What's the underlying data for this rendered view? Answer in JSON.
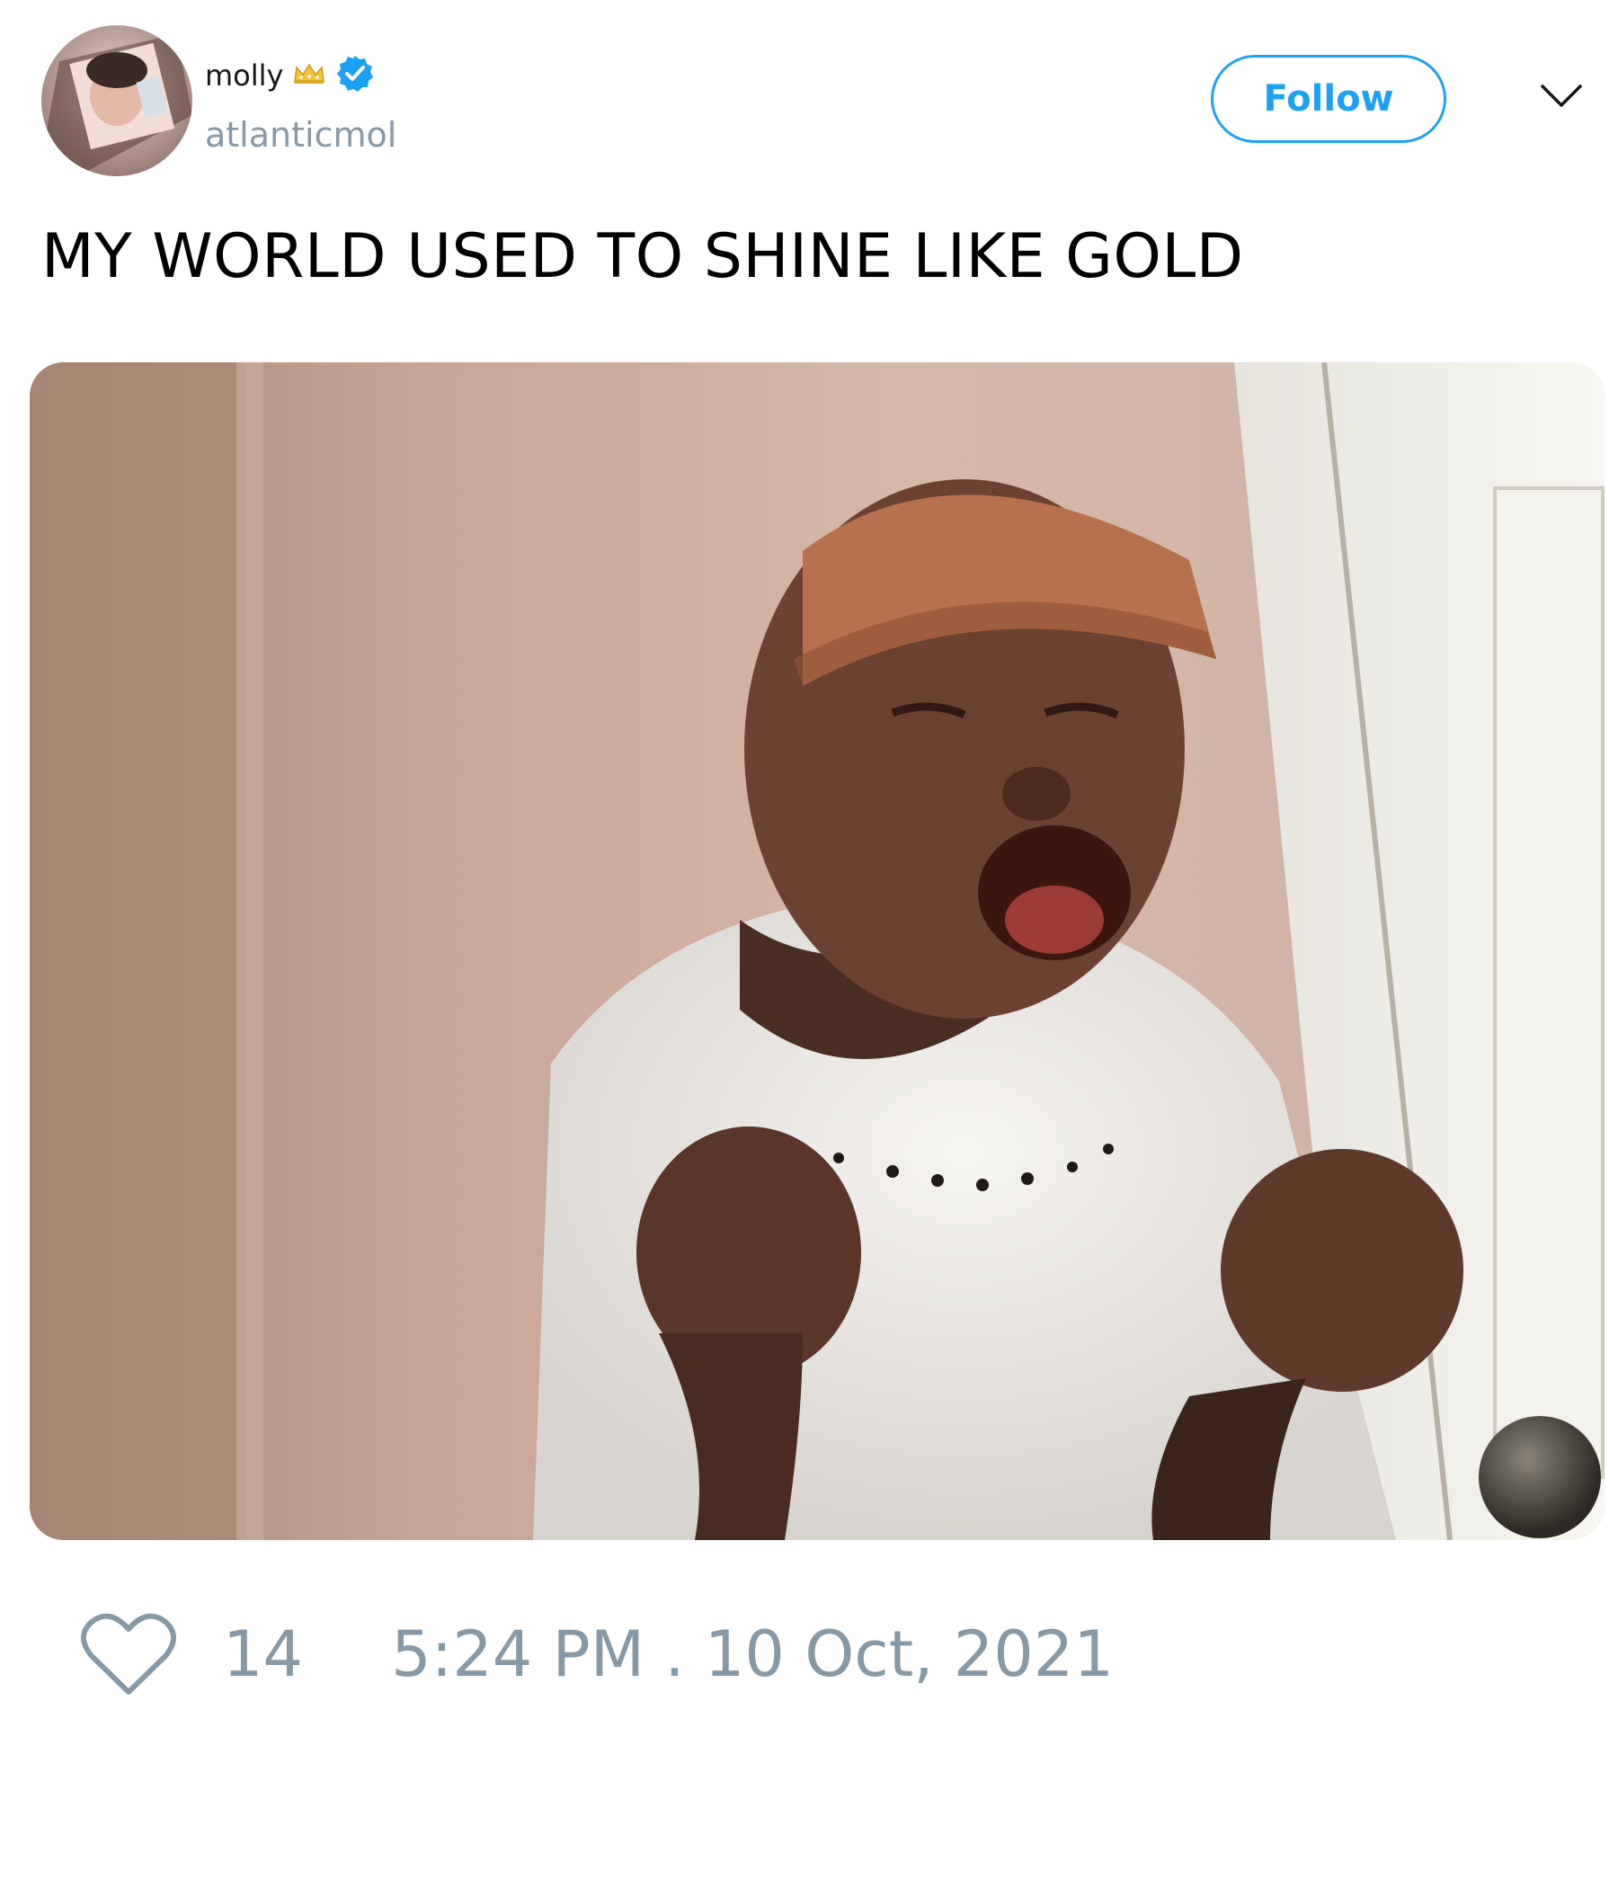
{
  "user": {
    "display_name": "molly",
    "handle": "atlanticmol",
    "badges": [
      "crown-icon",
      "verified-icon"
    ]
  },
  "actions": {
    "follow_label": "Follow",
    "menu_icon": "chevron-down-icon"
  },
  "tweet": {
    "text": "MY WORLD USED TO SHINE LIKE GOLD",
    "likes": "14",
    "timestamp": "5:24 PM . 10 Oct, 2021"
  },
  "colors": {
    "accent": "#1da1f2",
    "muted": "#8899a6",
    "text": "#000000"
  }
}
